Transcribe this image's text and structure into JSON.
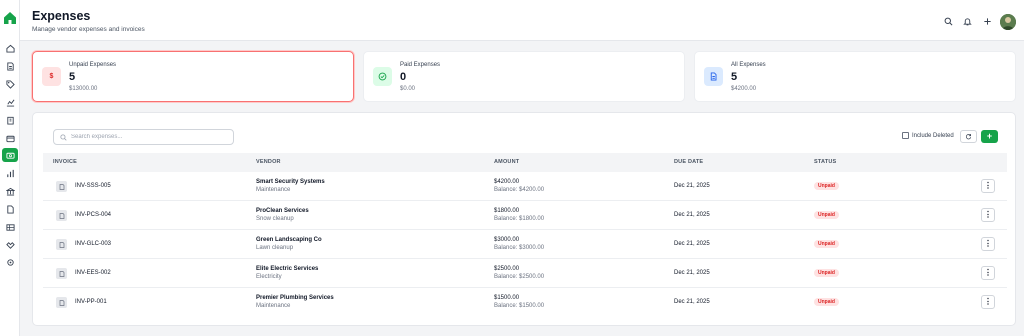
{
  "header": {
    "title": "Expenses",
    "subtitle": "Manage vendor expenses and invoices"
  },
  "icons": {
    "header": [
      "search-icon",
      "bell-icon",
      "plus-icon"
    ],
    "sidebar": [
      "home-icon",
      "document-icon",
      "tag-icon",
      "chart-icon",
      "building-icon",
      "wallet-icon",
      "expenses-icon",
      "bar-chart-icon",
      "bank-icon",
      "file-icon",
      "table-icon",
      "handshake-icon",
      "settings-icon"
    ]
  },
  "summary": {
    "unpaid": {
      "label": "Unpaid Expenses",
      "count": "5",
      "amount": "$13000.00",
      "icon_text": "$"
    },
    "paid": {
      "label": "Paid Expenses",
      "count": "0",
      "amount": "$0.00"
    },
    "all": {
      "label": "All Expenses",
      "count": "5",
      "amount": "$4200.00"
    }
  },
  "toolbar": {
    "search_placeholder": "Search expenses...",
    "include_deleted_label": "Include Deleted",
    "add_label": "+"
  },
  "table": {
    "columns": [
      "INVOICE",
      "VENDOR",
      "AMOUNT",
      "DUE DATE",
      "STATUS"
    ],
    "rows": [
      {
        "invoice": "INV-SSS-005",
        "vendor": "Smart Security Systems",
        "category": "Maintenance",
        "amount": "$4200.00",
        "balance": "Balance: $4200.00",
        "due": "Dec 21, 2025",
        "status": "Unpaid"
      },
      {
        "invoice": "INV-PCS-004",
        "vendor": "ProClean Services",
        "category": "Snow cleanup",
        "amount": "$1800.00",
        "balance": "Balance: $1800.00",
        "due": "Dec 21, 2025",
        "status": "Unpaid"
      },
      {
        "invoice": "INV-GLC-003",
        "vendor": "Green Landscaping Co",
        "category": "Lawn cleanup",
        "amount": "$3000.00",
        "balance": "Balance: $3000.00",
        "due": "Dec 21, 2025",
        "status": "Unpaid"
      },
      {
        "invoice": "INV-EES-002",
        "vendor": "Elite Electric Services",
        "category": "Electricity",
        "amount": "$2500.00",
        "balance": "Balance: $2500.00",
        "due": "Dec 21, 2025",
        "status": "Unpaid"
      },
      {
        "invoice": "INV-PP-001",
        "vendor": "Premier Plumbing Services",
        "category": "Maintenance",
        "amount": "$1500.00",
        "balance": "Balance: $1500.00",
        "due": "Dec 21, 2025",
        "status": "Unpaid"
      }
    ]
  },
  "colors": {
    "accent": "#16a34a",
    "unpaid_badge_bg": "#fee2e2",
    "unpaid_badge_text": "#dc2626",
    "selected_card_border": "#f87171"
  }
}
